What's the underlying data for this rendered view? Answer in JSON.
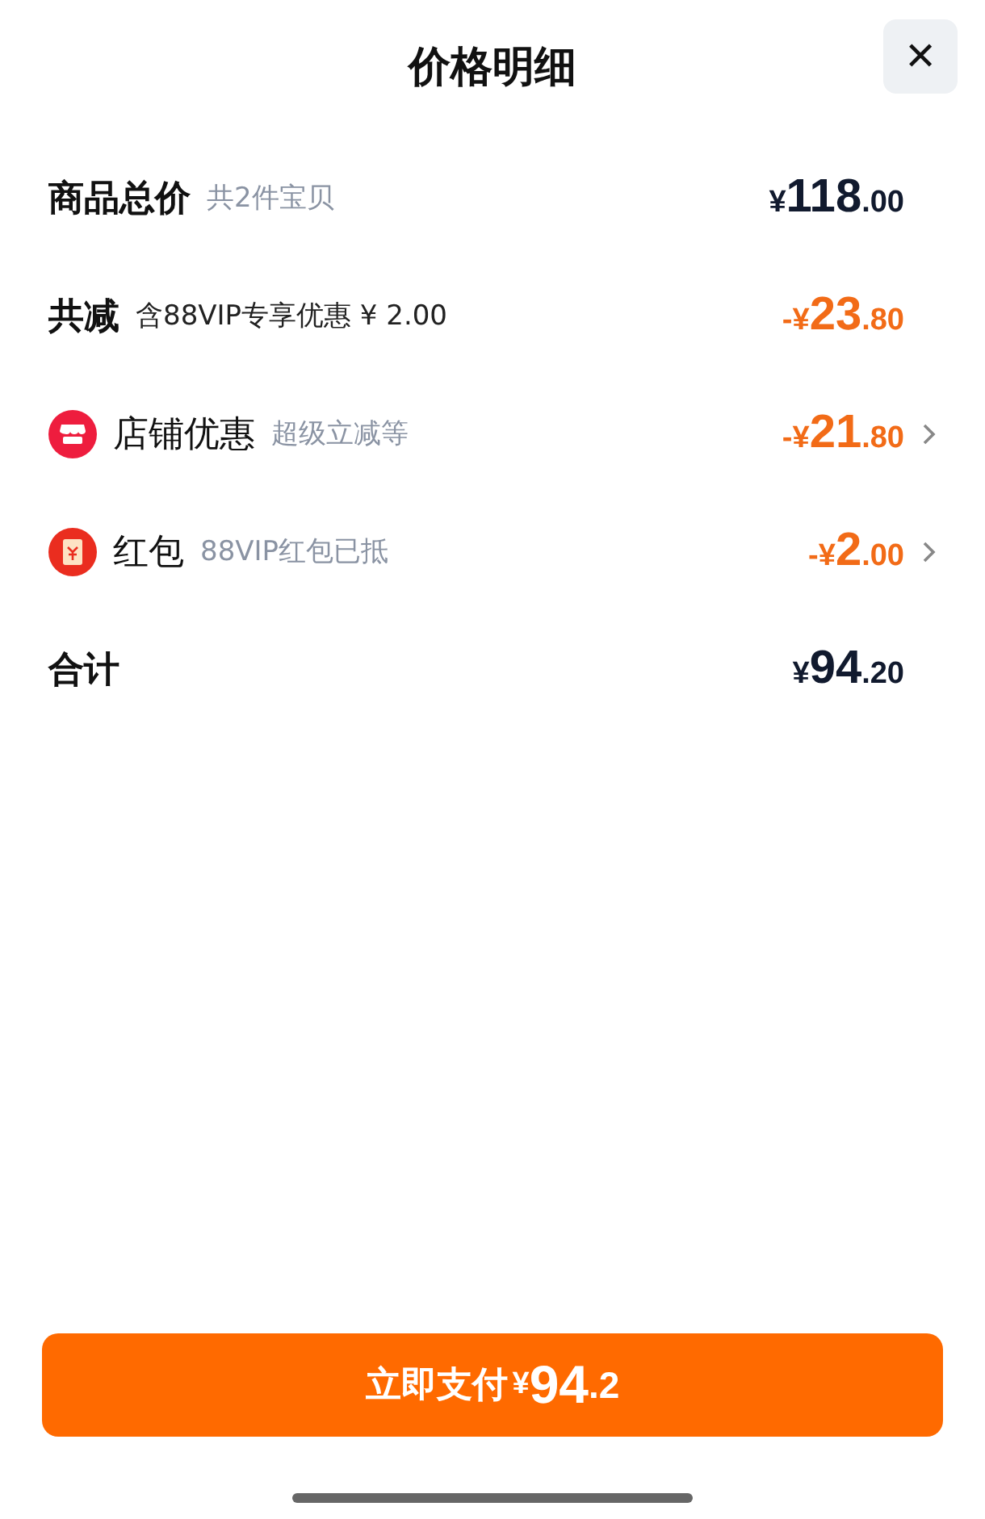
{
  "sheet": {
    "title": "价格明细",
    "close": "✕"
  },
  "rows": [
    {
      "kind": "plain",
      "label": "商品总价",
      "note": "共2件宝贝",
      "discount": false,
      "amount": {
        "currency": "¥",
        "whole": "118",
        "fraction": ".00"
      }
    },
    {
      "kind": "plain",
      "label": "共减",
      "note": "含88VIP专享优惠 ¥ 2.00",
      "discount": true,
      "amount": {
        "sign": "-",
        "currency": "¥",
        "whole": "23",
        "fraction": ".80"
      }
    },
    {
      "kind": "shop",
      "label": "店铺优惠",
      "note": "超级立减等",
      "discount": true,
      "amount": {
        "sign": "-",
        "currency": "¥",
        "whole": "21",
        "fraction": ".80"
      }
    },
    {
      "kind": "packet",
      "label": "红包",
      "note": "88VIP红包已抵",
      "discount": true,
      "amount": {
        "sign": "-",
        "currency": "¥",
        "whole": "2",
        "fraction": ".00"
      }
    },
    {
      "kind": "plain",
      "label": "合计",
      "discount": false,
      "amount": {
        "currency": "¥",
        "whole": "94",
        "fraction": ".20"
      }
    }
  ],
  "pay_button": {
    "label": "立即支付",
    "currency": "¥",
    "whole": "94",
    "fraction": ".2"
  }
}
